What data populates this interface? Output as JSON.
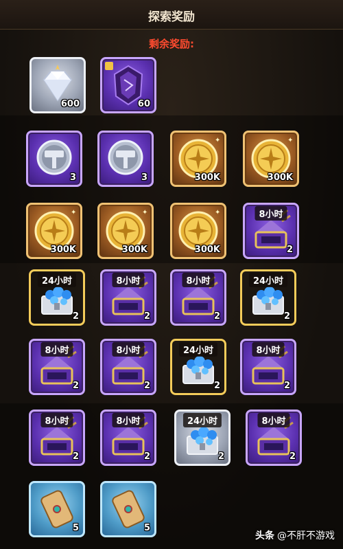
{
  "panel": {
    "title": "探索奖励",
    "subtitle": "剩余奖励:"
  },
  "rewards": [
    {
      "kind": "diamond",
      "count": "600",
      "tag": "",
      "frame": "silver"
    },
    {
      "kind": "purple-shard",
      "count": "60",
      "tag": "",
      "frame": "purple"
    },
    {
      "kind": "hammer",
      "count": "3",
      "tag": "",
      "frame": "purple"
    },
    {
      "kind": "hammer",
      "count": "3",
      "tag": "",
      "frame": "purple"
    },
    {
      "kind": "gold-coin",
      "count": "300K",
      "tag": "",
      "frame": "gold"
    },
    {
      "kind": "gold-coin",
      "count": "300K",
      "tag": "",
      "frame": "gold"
    },
    {
      "kind": "gold-coin",
      "count": "300K",
      "tag": "",
      "frame": "gold"
    },
    {
      "kind": "gold-coin",
      "count": "300K",
      "tag": "",
      "frame": "gold"
    },
    {
      "kind": "gold-coin",
      "count": "300K",
      "tag": "",
      "frame": "gold"
    },
    {
      "kind": "purple-chest",
      "count": "2",
      "tag": "8小时",
      "frame": "purple"
    },
    {
      "kind": "blue-chest",
      "count": "2",
      "tag": "24小时",
      "frame": "goldbox"
    },
    {
      "kind": "purple-chest",
      "count": "2",
      "tag": "8小时",
      "frame": "purple"
    },
    {
      "kind": "purple-chest",
      "count": "2",
      "tag": "8小时",
      "frame": "purple"
    },
    {
      "kind": "blue-chest",
      "count": "2",
      "tag": "24小时",
      "frame": "goldbox"
    },
    {
      "kind": "purple-chest",
      "count": "2",
      "tag": "8小时",
      "frame": "purple"
    },
    {
      "kind": "purple-chest",
      "count": "2",
      "tag": "8小时",
      "frame": "purple"
    },
    {
      "kind": "blue-chest",
      "count": "2",
      "tag": "24小时",
      "frame": "goldbox"
    },
    {
      "kind": "purple-chest",
      "count": "2",
      "tag": "8小时",
      "frame": "purple"
    },
    {
      "kind": "purple-chest",
      "count": "2",
      "tag": "8小时",
      "frame": "purple"
    },
    {
      "kind": "purple-chest",
      "count": "2",
      "tag": "8小时",
      "frame": "purple"
    },
    {
      "kind": "blue-chest",
      "count": "2",
      "tag": "24小时",
      "frame": "silver"
    },
    {
      "kind": "purple-chest",
      "count": "2",
      "tag": "8小时",
      "frame": "purple"
    },
    {
      "kind": "scroll",
      "count": "5",
      "tag": "",
      "frame": "blue"
    },
    {
      "kind": "scroll",
      "count": "5",
      "tag": "",
      "frame": "blue"
    }
  ],
  "watermark": {
    "logo": "头条",
    "handle": "@不肝不游戏"
  },
  "colors": {
    "title": "#f2e6d0",
    "subtitle": "#ff4b2f",
    "purple_frame": "#c8a6ff",
    "gold_frame": "#f0c274"
  }
}
